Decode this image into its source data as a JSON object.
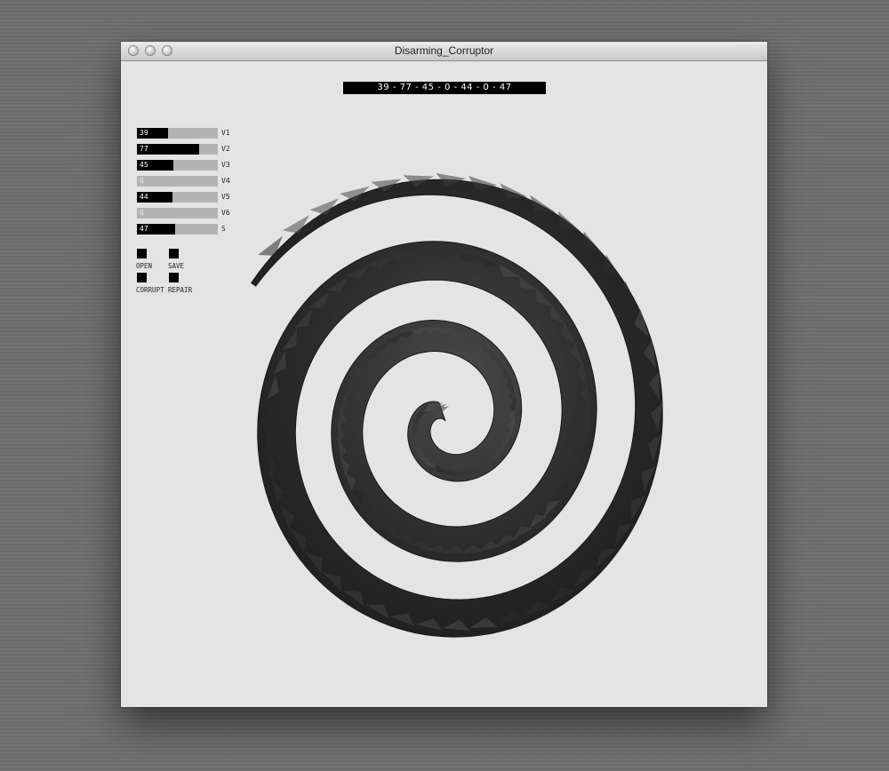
{
  "window": {
    "title": "Disarming_Corruptor"
  },
  "readout": "39 - 77 - 45 - 0 - 44 - 0 - 47",
  "sliders": [
    {
      "label": "V1",
      "value": 39,
      "display": "39"
    },
    {
      "label": "V2",
      "value": 77,
      "display": "77"
    },
    {
      "label": "V3",
      "value": 45,
      "display": "45"
    },
    {
      "label": "V4",
      "value": 0,
      "display": "0"
    },
    {
      "label": "V5",
      "value": 44,
      "display": "44"
    },
    {
      "label": "V6",
      "value": 0,
      "display": "0"
    },
    {
      "label": "S",
      "value": 47,
      "display": "47"
    }
  ],
  "buttons": {
    "open": "OPEN",
    "save": "SAVE",
    "corrupt": "CORRUPT",
    "repair": "REPAIR"
  },
  "colors": {
    "background": "#e4e4e4",
    "spiral": "#2b2b2b",
    "slider_track": "#b3b3b3",
    "slider_fill": "#000000"
  }
}
